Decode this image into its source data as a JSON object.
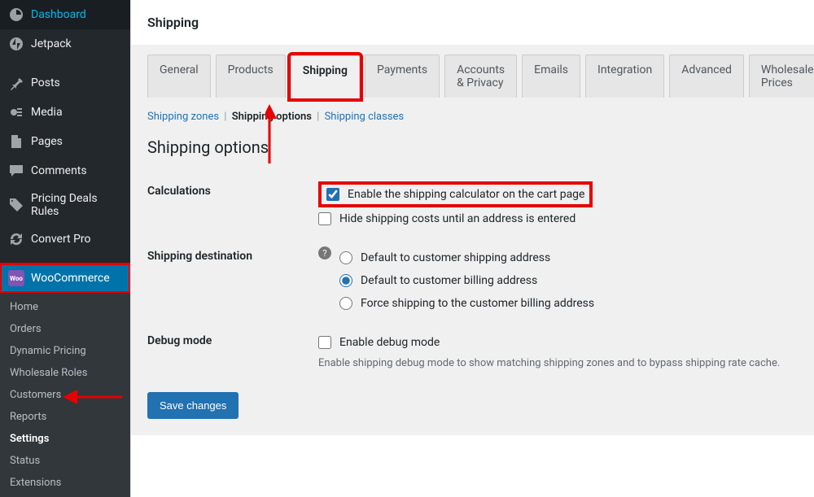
{
  "sidebar": {
    "groups": [
      [
        {
          "icon": "dashboard-icon",
          "label": "Dashboard"
        },
        {
          "icon": "jetpack-icon",
          "label": "Jetpack"
        }
      ],
      [
        {
          "icon": "pin-icon",
          "label": "Posts"
        },
        {
          "icon": "media-icon",
          "label": "Media"
        },
        {
          "icon": "page-icon",
          "label": "Pages"
        },
        {
          "icon": "comment-icon",
          "label": "Comments"
        },
        {
          "icon": "tag-icon",
          "label": "Pricing Deals Rules"
        },
        {
          "icon": "convert-icon",
          "label": "Convert Pro"
        }
      ]
    ],
    "woocommerce": {
      "label": "WooCommerce",
      "badge": "Woo",
      "submenu": [
        "Home",
        "Orders",
        "Dynamic Pricing",
        "Wholesale Roles",
        "Customers",
        "Reports",
        "Settings",
        "Status",
        "Extensions"
      ],
      "current": "Settings"
    }
  },
  "page": {
    "title": "Shipping"
  },
  "tabs": {
    "items": [
      "General",
      "Products",
      "Shipping",
      "Payments",
      "Accounts & Privacy",
      "Emails",
      "Integration",
      "Advanced",
      "Wholesale Prices"
    ],
    "active": "Shipping"
  },
  "subtabs": {
    "items": [
      "Shipping zones",
      "Shipping options",
      "Shipping classes"
    ],
    "current": "Shipping options"
  },
  "section": {
    "title": "Shipping options"
  },
  "form": {
    "calculations": {
      "label": "Calculations",
      "opts": [
        {
          "type": "checkbox",
          "label": "Enable the shipping calculator on the cart page",
          "checked": true,
          "highlight": true
        },
        {
          "type": "checkbox",
          "label": "Hide shipping costs until an address is entered",
          "checked": false
        }
      ]
    },
    "destination": {
      "label": "Shipping destination",
      "help": "?",
      "opts": [
        {
          "type": "radio",
          "label": "Default to customer shipping address",
          "checked": false
        },
        {
          "type": "radio",
          "label": "Default to customer billing address",
          "checked": true
        },
        {
          "type": "radio",
          "label": "Force shipping to the customer billing address",
          "checked": false
        }
      ]
    },
    "debug": {
      "label": "Debug mode",
      "opt": {
        "type": "checkbox",
        "label": "Enable debug mode",
        "checked": false
      },
      "desc": "Enable shipping debug mode to show matching shipping zones and to bypass shipping rate cache."
    },
    "submit": "Save changes"
  }
}
